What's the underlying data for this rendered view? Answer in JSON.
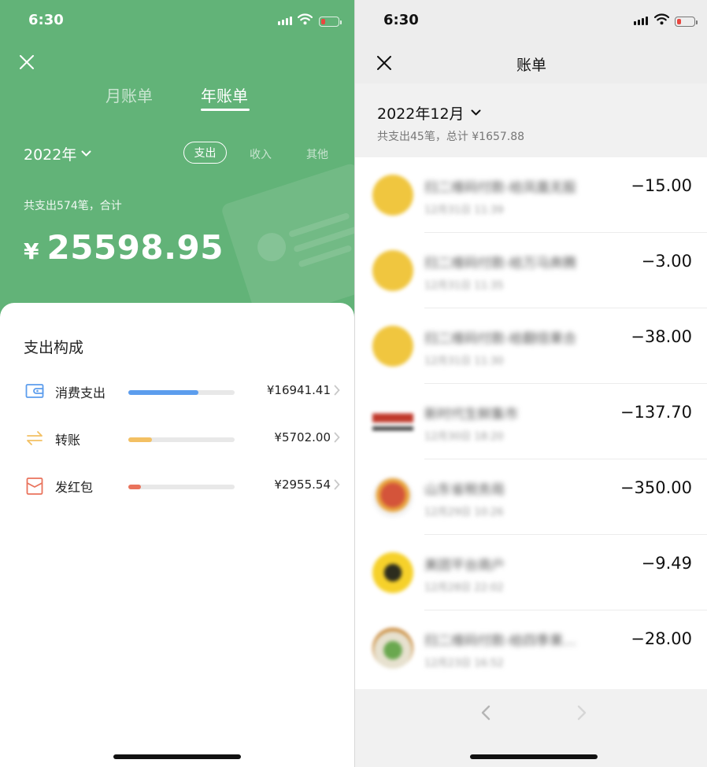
{
  "status": {
    "time": "6:30"
  },
  "left": {
    "tabs": {
      "month": "月账单",
      "year": "年账单"
    },
    "year_select": "2022年",
    "filters": {
      "expense": "支出",
      "income": "收入",
      "other": "其他"
    },
    "summary": "共支出574笔，合计",
    "currency": "¥",
    "total": "25598.95",
    "breakdown_title": "支出构成",
    "categories": [
      {
        "name": "消费支出",
        "amount": "¥16941.41",
        "share": 0.66,
        "color": "#5c9ded",
        "icon": "wallet-icon"
      },
      {
        "name": "转账",
        "amount": "¥5702.00",
        "share": 0.22,
        "color": "#f3c063",
        "icon": "transfer-icon"
      },
      {
        "name": "发红包",
        "amount": "¥2955.54",
        "share": 0.12,
        "color": "#e9735c",
        "icon": "red-envelope-icon"
      }
    ]
  },
  "right": {
    "title": "账单",
    "month": "2022年12月",
    "summary": "共支出45笔，总计 ¥1657.88",
    "transactions": [
      {
        "name": "扫二维码付款-给凤凰无股",
        "time": "12月31日 11:39",
        "amount": "−15.00"
      },
      {
        "name": "扫二维码付款-给万马奔腾",
        "time": "12月31日 11:35",
        "amount": "−3.00"
      },
      {
        "name": "扫二维码付款-给翻倍果合",
        "time": "12月31日 11:30",
        "amount": "−38.00"
      },
      {
        "name": "新时代生鲜集市",
        "time": "12月30日 18:20",
        "amount": "−137.70"
      },
      {
        "name": "山东省税务局",
        "time": "12月29日 10:26",
        "amount": "−350.00"
      },
      {
        "name": "美团平台商户",
        "time": "12月28日 22:02",
        "amount": "−9.49"
      },
      {
        "name": "扫二维码付款-给四季果…",
        "time": "12月23日 16:52",
        "amount": "−28.00"
      }
    ]
  }
}
